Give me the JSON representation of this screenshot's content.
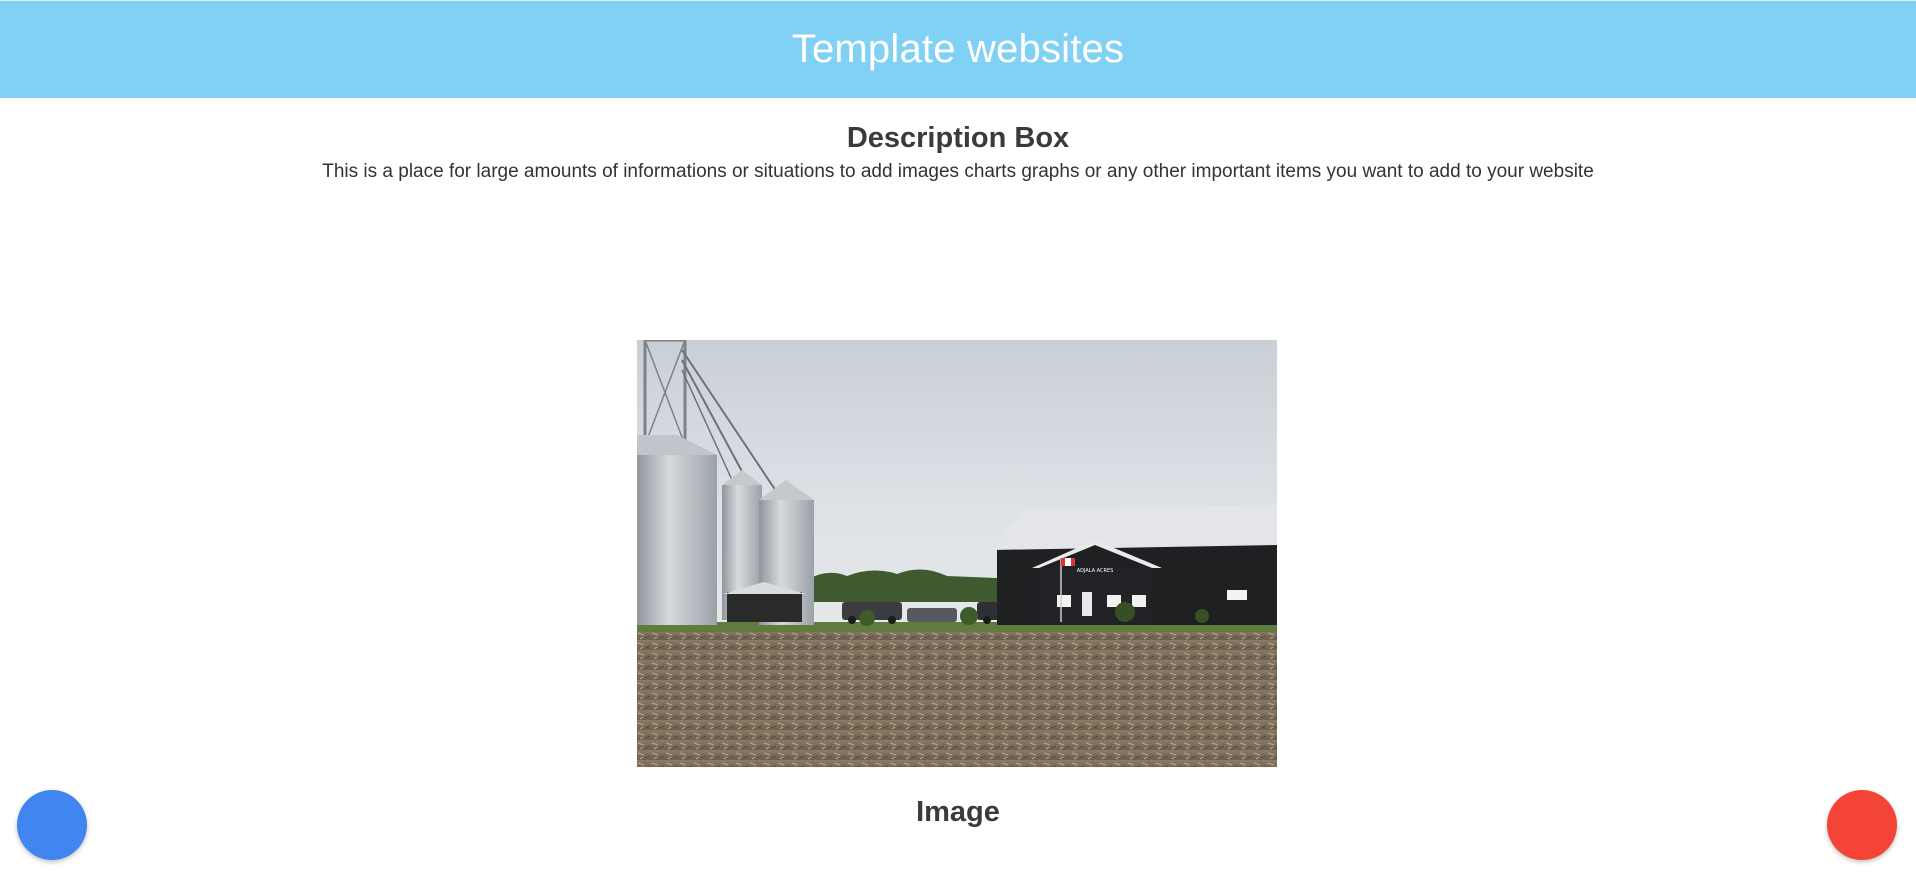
{
  "header": {
    "title": "Template websites",
    "color": "#81d1f5"
  },
  "description": {
    "title": "Description Box",
    "text": "This is a place for large amounts of informations or situations to add images charts graphs or any other important items you want to add to your website"
  },
  "image_section": {
    "caption": "Image",
    "sign_text": "ADJALA ACRES"
  },
  "fabs": {
    "left_color": "#4186f0",
    "right_color": "#f44337"
  }
}
